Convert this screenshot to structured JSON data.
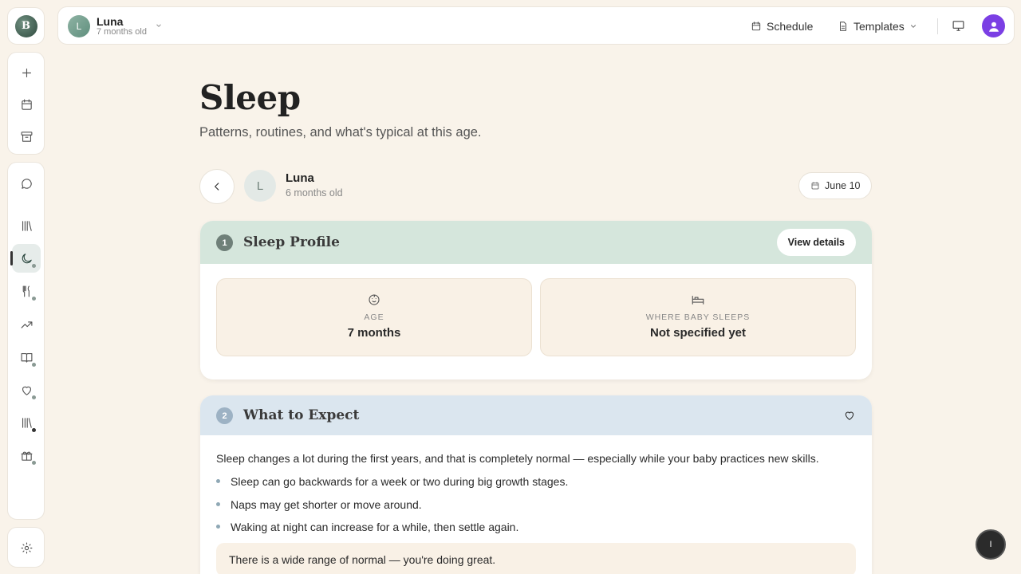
{
  "app": {
    "logo_letter": "B"
  },
  "topbar": {
    "profile_initial": "L",
    "profile_name": "Luna",
    "profile_age": "7 months old",
    "schedule_label": "Schedule",
    "templates_label": "Templates"
  },
  "page": {
    "title": "Sleep",
    "subtitle": "Patterns, routines, and what's typical at this age."
  },
  "child": {
    "initial": "L",
    "name": "Luna",
    "age": "6 months old",
    "date": "June 10"
  },
  "sleep_profile": {
    "number": "1",
    "title": "Sleep Profile",
    "view_details_label": "View details",
    "stats": [
      {
        "label": "AGE",
        "value": "7 months",
        "icon": "baby-face-icon"
      },
      {
        "label": "WHERE BABY SLEEPS",
        "value": "Not specified yet",
        "icon": "bed-icon"
      }
    ]
  },
  "what_to_expect": {
    "number": "2",
    "title": "What to Expect",
    "intro": "Sleep changes a lot during the first years, and that is completely normal — especially while your baby practices new skills.",
    "bullets": [
      "Sleep can go backwards for a week or two during big growth stages.",
      "Naps may get shorter or move around.",
      "Waking at night can increase for a while, then settle again."
    ],
    "note": "There is a wide range of normal — you're doing great."
  },
  "float_button_label": "I"
}
